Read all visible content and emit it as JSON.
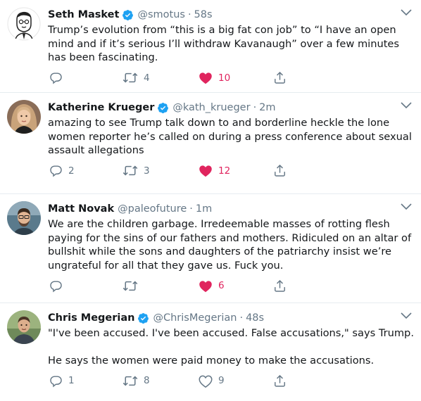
{
  "colors": {
    "text": "#14171a",
    "muted": "#657786",
    "verified": "#1da1f2",
    "like": "#e0245e",
    "divider": "#e6ecf0"
  },
  "tweets": [
    {
      "name": "Seth Masket",
      "handle": "@smotus",
      "time": "58s",
      "text": [
        "Trump’s evolution from “this is a big fat con job” to “I have an open mind and if it’s serious I’ll withdraw Kavanaugh” over a few minutes has been fascinating."
      ],
      "replies": "",
      "retweets": "4",
      "likes": "10",
      "liked": true
    },
    {
      "name": "Katherine Krueger",
      "handle": "@kath_krueger",
      "time": "2m",
      "text": [
        "amazing to see Trump talk down to and borderline heckle the lone women reporter he’s called on during a press conference about sexual assault allegations"
      ],
      "replies": "2",
      "retweets": "3",
      "likes": "12",
      "liked": true
    },
    {
      "name": "Matt Novak",
      "handle": "@paleofuture",
      "time": "1m",
      "text": [
        "We are the children garbage. Irredeemable masses of rotting flesh paying for the sins of our fathers and mothers. Ridiculed on an altar of bullshit while the sons and daughters of the patriarchy insist we’re ungrateful for all that they gave us. Fuck you."
      ],
      "replies": "",
      "retweets": "",
      "likes": "6",
      "liked": true
    },
    {
      "name": "Chris Megerian",
      "handle": "@ChrisMegerian",
      "time": "48s",
      "text": [
        "\"I've been accused. I've been accused. False accusations,\" says Trump.",
        "He says the women were paid money to make the accusations."
      ],
      "replies": "1",
      "retweets": "8",
      "likes": "9",
      "liked": false
    }
  ],
  "separator": "·",
  "icons": {
    "reply": "reply-icon",
    "retweet": "retweet-icon",
    "like": "heart-icon",
    "share": "share-icon",
    "verified": "verified-badge-icon",
    "caret": "chevron-down-icon"
  }
}
